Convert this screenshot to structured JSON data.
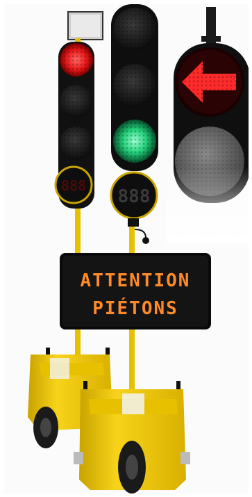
{
  "sign": {
    "line1": "ATTENTION",
    "line2": "PIÉTONS"
  },
  "left_unit": {
    "lights": [
      "red",
      "off",
      "off"
    ],
    "countdown_display": "888"
  },
  "right_unit": {
    "lights": [
      "off",
      "off",
      "green"
    ],
    "countdown_display": "888"
  },
  "arrow_signal": {
    "top": "red-left-arrow",
    "bottom": "off"
  },
  "colors": {
    "red_on": "#ff2a2a",
    "green_on": "#35e08a",
    "amber_text": "#ff8a2a",
    "trailer_yellow": "#f5cf12",
    "housing_black": "#111111"
  }
}
